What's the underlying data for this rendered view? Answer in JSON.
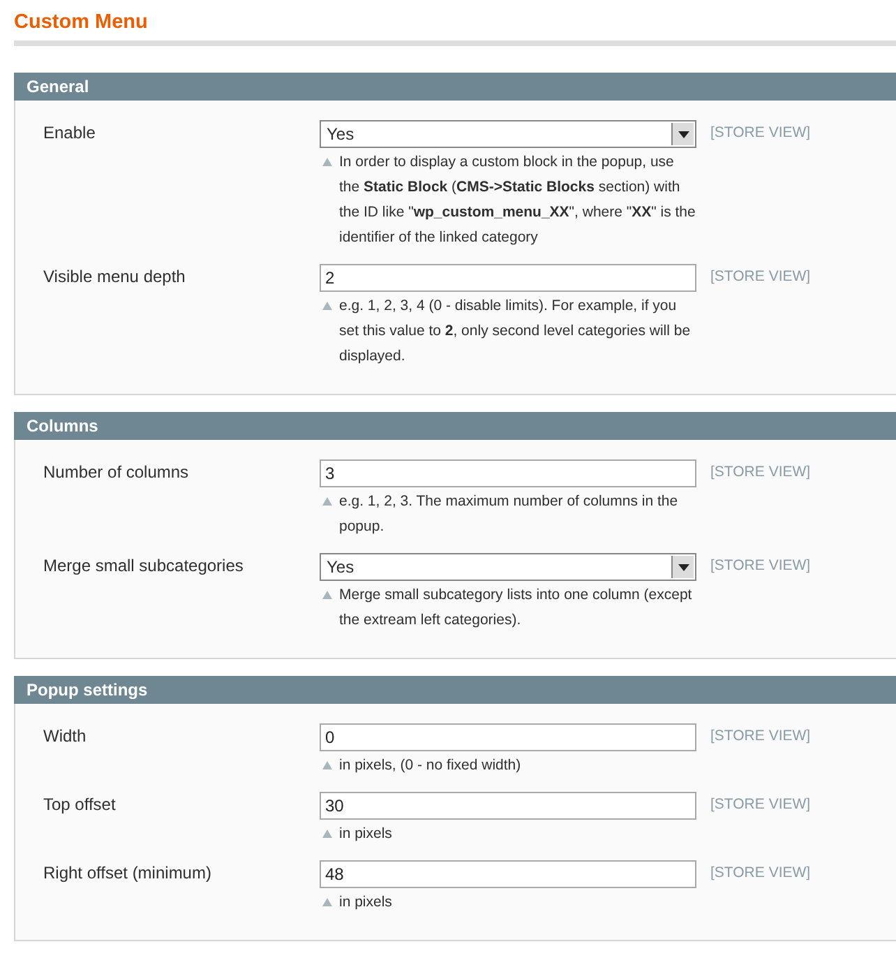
{
  "page_title": "Custom Menu",
  "sections": [
    {
      "title": "General",
      "fields": [
        {
          "label": "Enable",
          "kind": "select",
          "value": "Yes",
          "scope": "[STORE VIEW]",
          "hint": "In order to display a custom block in the popup, use the **Static Block** (**CMS->Static Blocks** section) with the ID like \"**wp_custom_menu_XX**\", where \"**XX**\" is the identifier of the linked category"
        },
        {
          "label": "Visible menu depth",
          "kind": "text",
          "value": "2",
          "scope": "[STORE VIEW]",
          "hint": "e.g. 1, 2, 3, 4 (0 - disable limits). For example, if you set this value to **2**, only second level categories will be displayed."
        }
      ]
    },
    {
      "title": "Columns",
      "fields": [
        {
          "label": "Number of columns",
          "kind": "text",
          "value": "3",
          "scope": "[STORE VIEW]",
          "hint": "e.g. 1, 2, 3. The maximum number of columns in the popup."
        },
        {
          "label": "Merge small subcategories",
          "kind": "select",
          "value": "Yes",
          "scope": "[STORE VIEW]",
          "hint": "Merge small subcategory lists into one column (except the extream left categories)."
        }
      ]
    },
    {
      "title": "Popup settings",
      "fields": [
        {
          "label": "Width",
          "kind": "text",
          "value": "0",
          "scope": "[STORE VIEW]",
          "hint": "in pixels, (0 - no fixed width)"
        },
        {
          "label": "Top offset",
          "kind": "text",
          "value": "30",
          "scope": "[STORE VIEW]",
          "hint": "in pixels"
        },
        {
          "label": "Right offset (minimum)",
          "kind": "text",
          "value": "48",
          "scope": "[STORE VIEW]",
          "hint": "in pixels"
        }
      ]
    }
  ]
}
